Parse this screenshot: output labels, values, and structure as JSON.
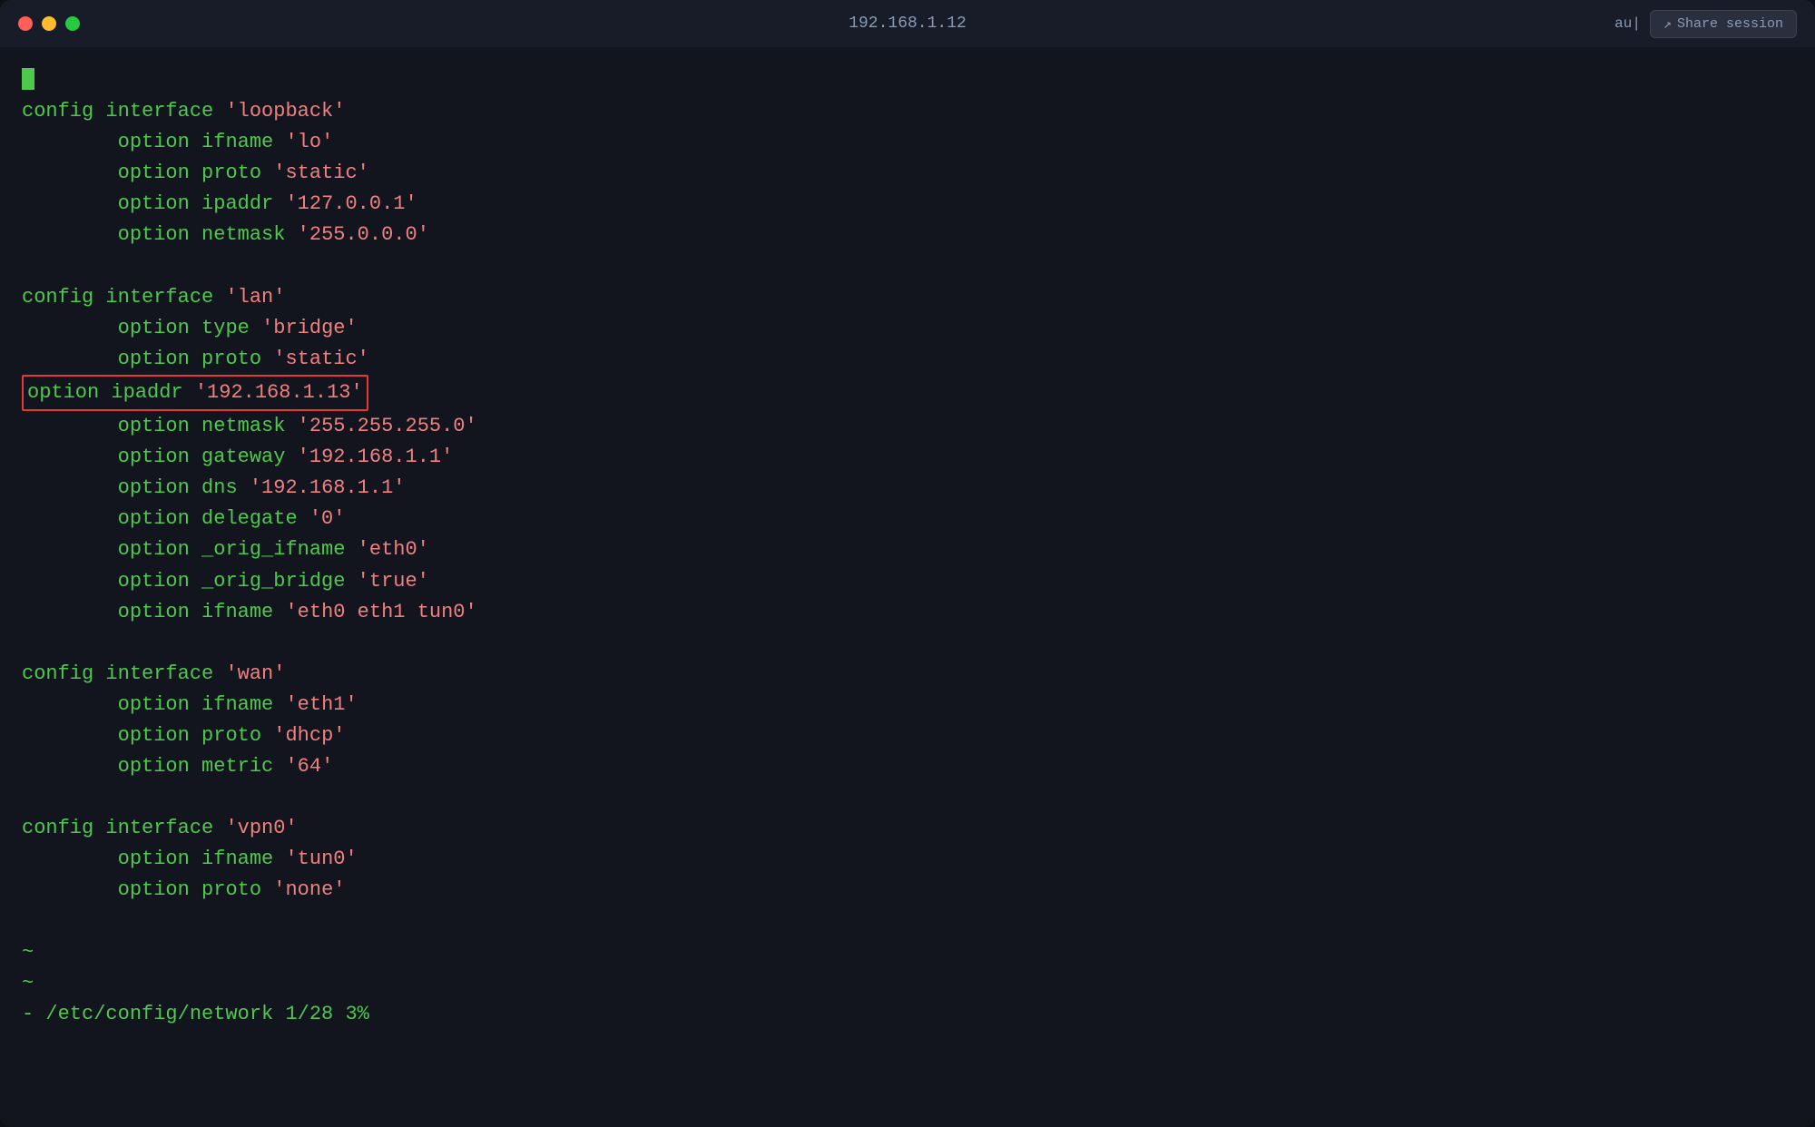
{
  "titlebar": {
    "title": "192.168.1.12",
    "user": "au|",
    "share_label": "Share session"
  },
  "terminal": {
    "cursor": "",
    "lines": [
      {
        "id": "blank1",
        "text": ""
      },
      {
        "id": "config-loopback",
        "text": "config interface 'loopback'"
      },
      {
        "id": "opt-ifname-lo",
        "text": "        option ifname 'lo'"
      },
      {
        "id": "opt-proto-static1",
        "text": "        option proto 'static'"
      },
      {
        "id": "opt-ipaddr-127",
        "text": "        option ipaddr '127.0.0.1'"
      },
      {
        "id": "opt-netmask-0",
        "text": "        option netmask '255.0.0.0'"
      },
      {
        "id": "blank2",
        "text": ""
      },
      {
        "id": "config-lan",
        "text": "config interface 'lan'"
      },
      {
        "id": "opt-type-bridge",
        "text": "        option type 'bridge'"
      },
      {
        "id": "opt-proto-static2",
        "text": "        option proto 'static'"
      },
      {
        "id": "opt-ipaddr-highlighted",
        "text": "        option ipaddr '192.168.1.13'",
        "highlighted": true
      },
      {
        "id": "opt-netmask-255",
        "text": "        option netmask '255.255.255.0'"
      },
      {
        "id": "opt-gateway",
        "text": "        option gateway '192.168.1.1'"
      },
      {
        "id": "opt-dns",
        "text": "        option dns '192.168.1.1'"
      },
      {
        "id": "opt-delegate",
        "text": "        option delegate '0'"
      },
      {
        "id": "opt-orig-ifname",
        "text": "        option _orig_ifname 'eth0'"
      },
      {
        "id": "opt-orig-bridge",
        "text": "        option _orig_bridge 'true'"
      },
      {
        "id": "opt-ifname-eth0",
        "text": "        option ifname 'eth0 eth1 tun0'"
      },
      {
        "id": "blank3",
        "text": ""
      },
      {
        "id": "config-wan",
        "text": "config interface 'wan'"
      },
      {
        "id": "opt-ifname-eth1",
        "text": "        option ifname 'eth1'"
      },
      {
        "id": "opt-proto-dhcp",
        "text": "        option proto 'dhcp'"
      },
      {
        "id": "opt-metric",
        "text": "        option metric '64'"
      },
      {
        "id": "blank4",
        "text": ""
      },
      {
        "id": "config-vpn0",
        "text": "config interface 'vpn0'"
      },
      {
        "id": "opt-ifname-tun0",
        "text": "        option ifname 'tun0'"
      },
      {
        "id": "opt-proto-none",
        "text": "        option proto 'none'"
      },
      {
        "id": "blank5",
        "text": ""
      },
      {
        "id": "tilde1",
        "text": "~"
      },
      {
        "id": "tilde2",
        "text": "~"
      },
      {
        "id": "status",
        "text": "- /etc/config/network 1/28 3%"
      }
    ]
  }
}
